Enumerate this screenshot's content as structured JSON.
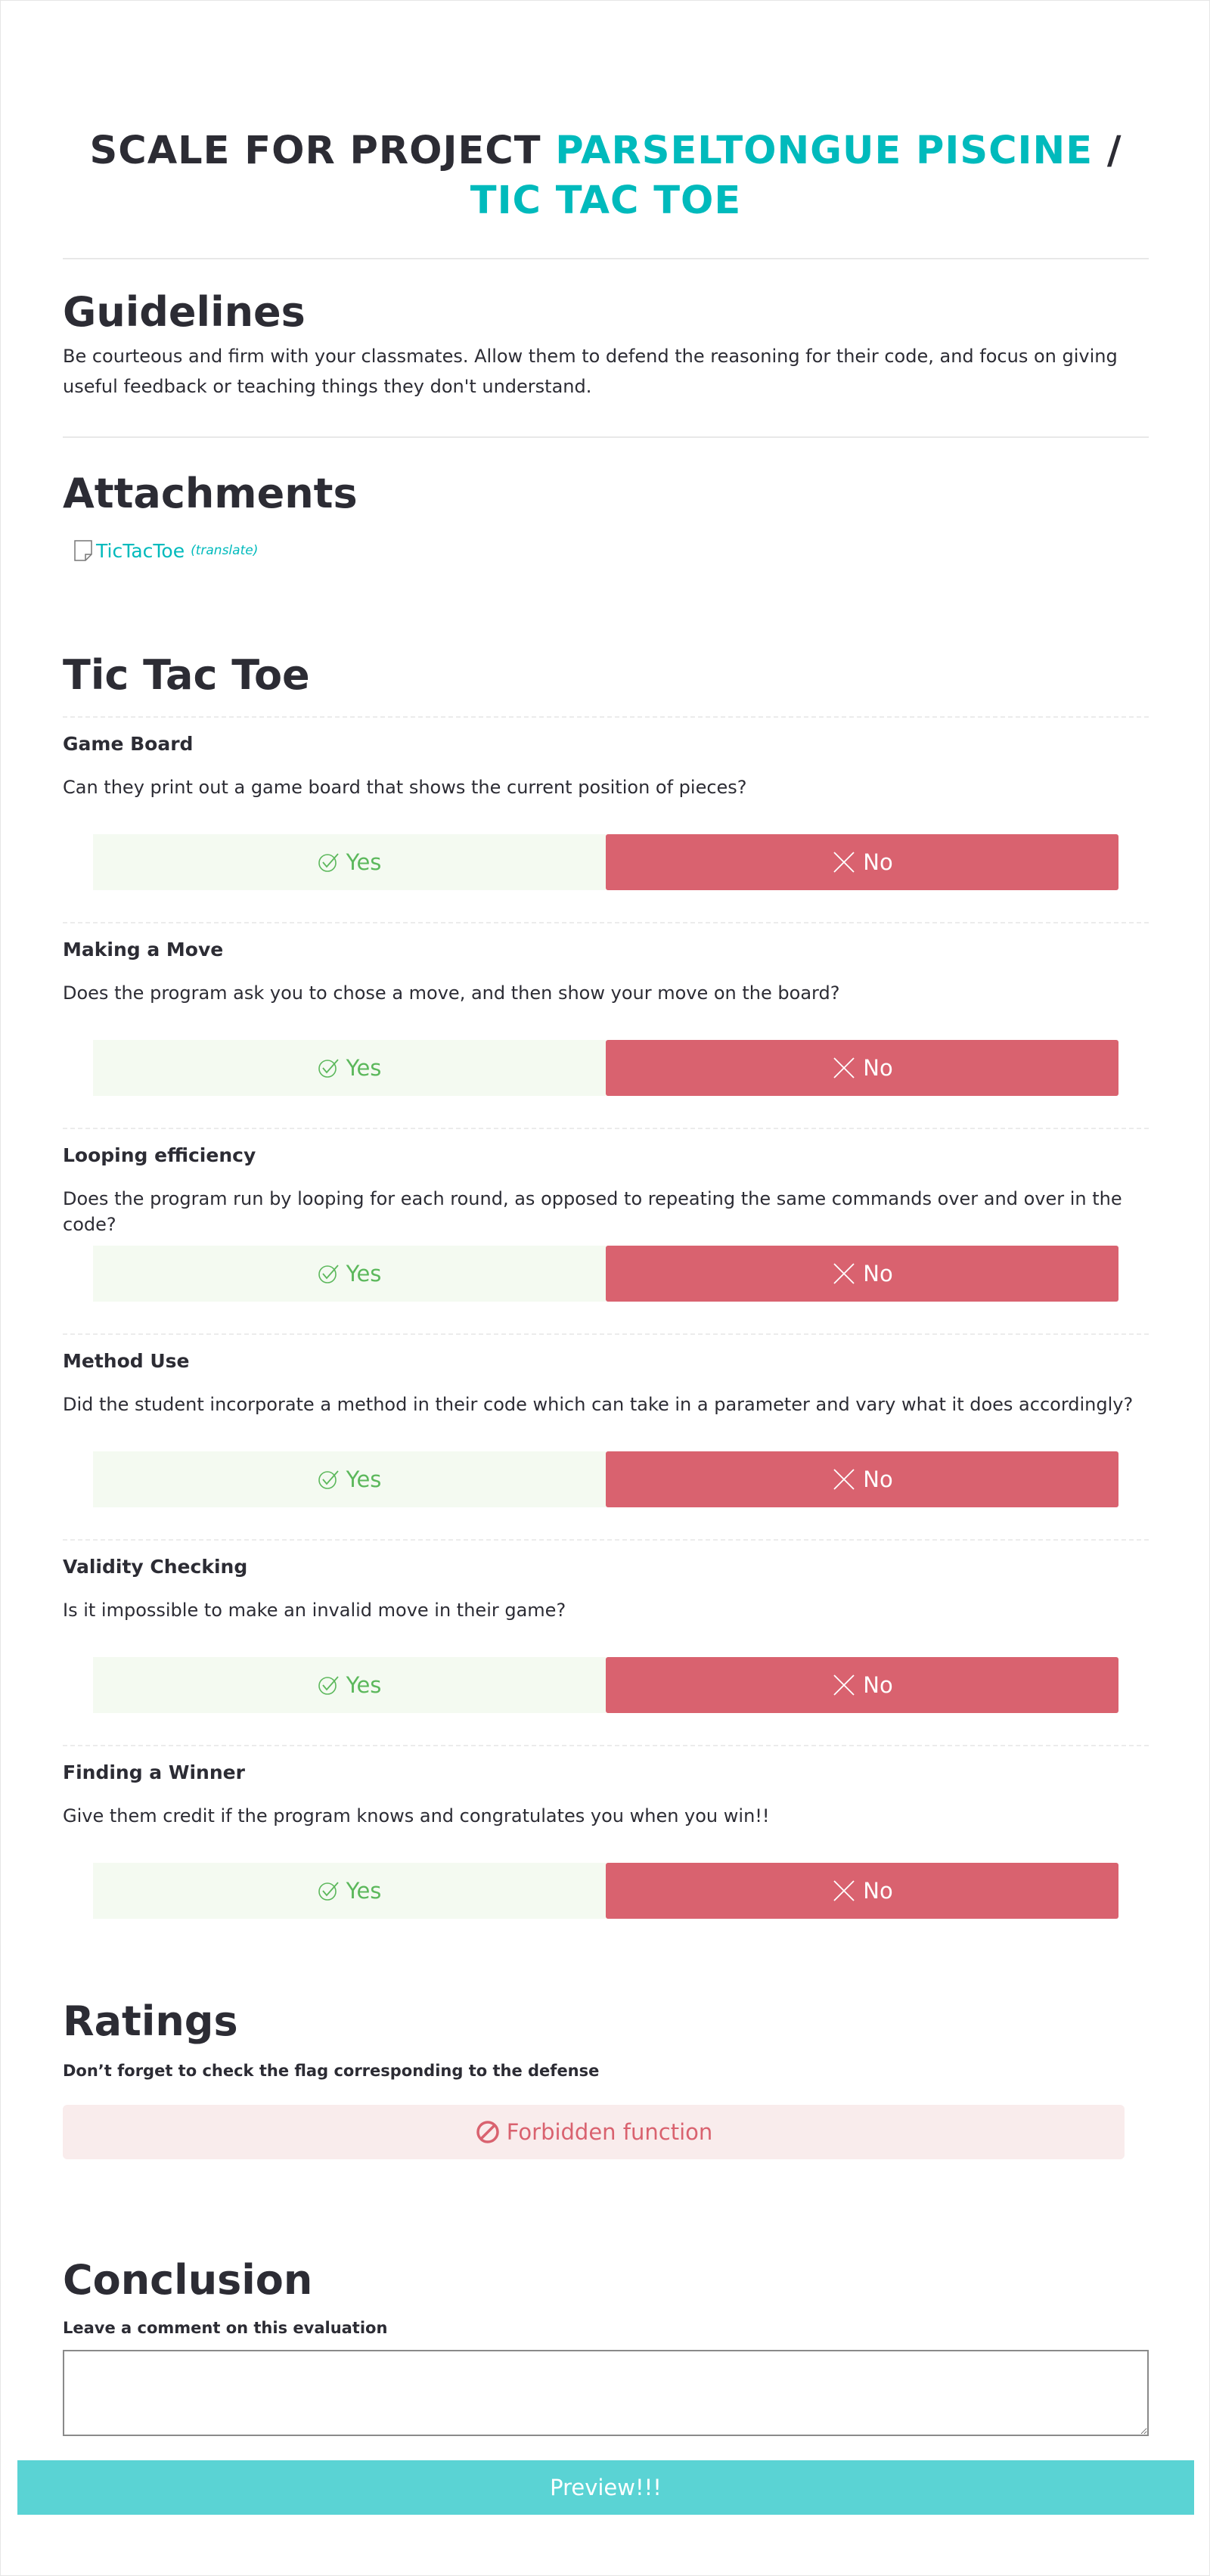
{
  "header": {
    "prefix": "SCALE FOR PROJECT ",
    "project": "PARSELTONGUE PISCINE",
    "slash": " / ",
    "subproject": "TIC TAC TOE"
  },
  "guidelines": {
    "heading": "Guidelines",
    "text": "Be courteous and firm with your classmates. Allow them to defend the reasoning for their code, and focus on giving useful feedback or teaching things they don't understand."
  },
  "attachments": {
    "heading": "Attachments",
    "file_icon": "file-icon",
    "link_label": "TicTacToe",
    "translate_label": "(translate)"
  },
  "section": {
    "heading": "Tic Tac Toe",
    "questions": [
      {
        "title": "Game Board",
        "text": "Can they print out a game board that shows the current position of pieces?",
        "yes": "Yes",
        "no": "No"
      },
      {
        "title": "Making a Move",
        "text": "Does the program ask you to chose a move, and then show your move on the board?",
        "yes": "Yes",
        "no": "No"
      },
      {
        "title": "Looping efficiency",
        "text": "Does the program run by looping for each round, as opposed to repeating the same commands over and over in the code?",
        "yes": "Yes",
        "no": "No"
      },
      {
        "title": "Method Use",
        "text": "Did the student incorporate a method in their code which can take in a parameter and vary what it does accordingly?",
        "yes": "Yes",
        "no": "No"
      },
      {
        "title": "Validity Checking",
        "text": "Is it impossible to make an invalid move in their game?",
        "yes": "Yes",
        "no": "No"
      },
      {
        "title": "Finding a Winner",
        "text": "Give them credit if the program knows and congratulates you when you win!!",
        "yes": "Yes",
        "no": "No"
      }
    ]
  },
  "ratings": {
    "heading": "Ratings",
    "note": "Don’t forget to check the flag corresponding to the defense",
    "flag_label": "Forbidden function"
  },
  "conclusion": {
    "heading": "Conclusion",
    "note": "Leave a comment on this evaluation",
    "comment_value": ""
  },
  "actions": {
    "preview_label": "Preview!!!"
  },
  "colors": {
    "accent": "#00babc",
    "yes": "#5cb85c",
    "no": "#d9626f",
    "preview": "#5ad3d4"
  }
}
